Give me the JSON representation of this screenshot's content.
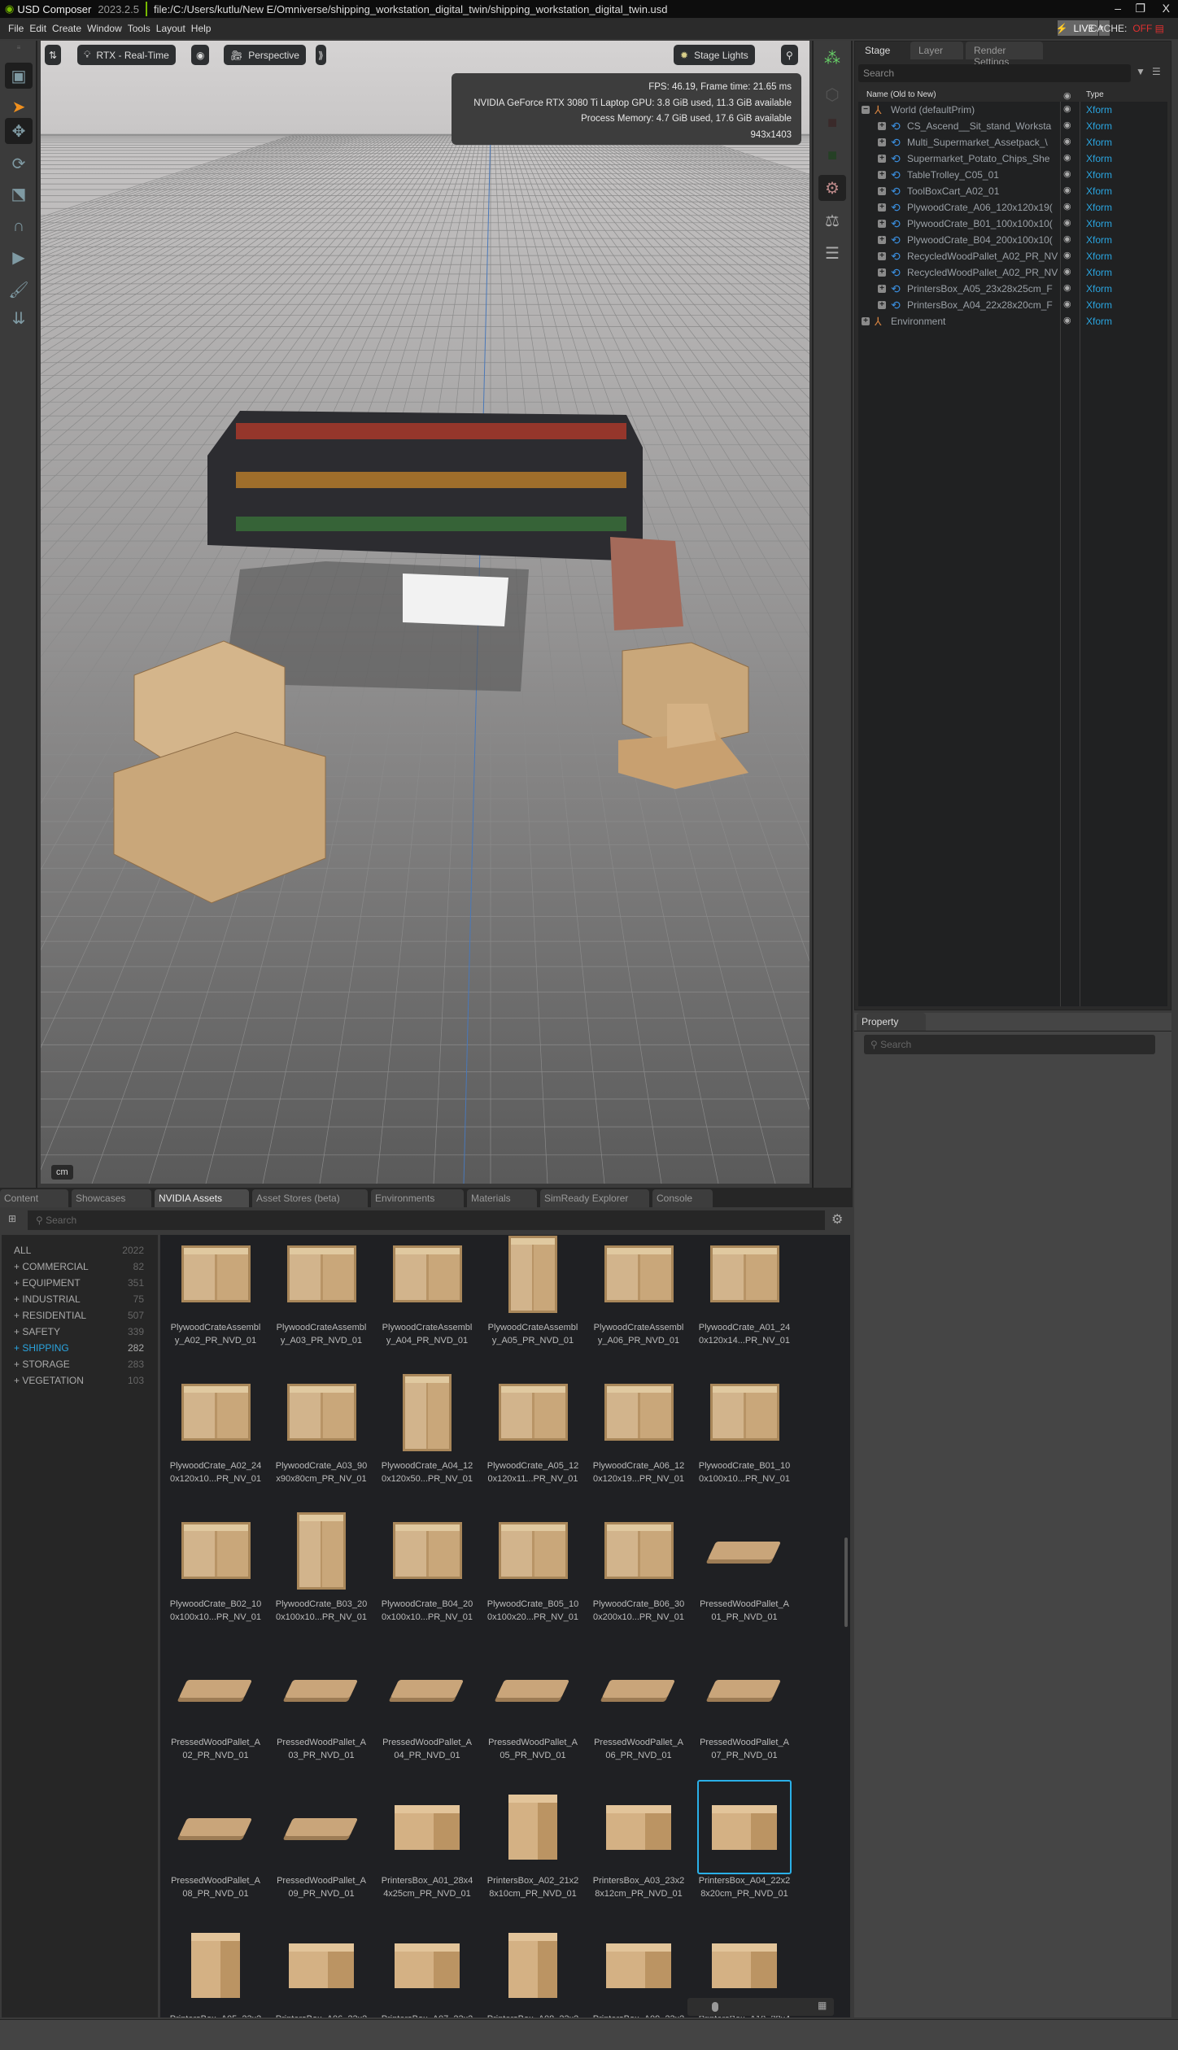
{
  "titlebar": {
    "app": "USD Composer",
    "version": "2023.2.5",
    "path": "file:/C:/Users/kutlu/New E/Omniverse/shipping_workstation_digital_twin/shipping_workstation_digital_twin.usd",
    "min": "–",
    "restore": "❐",
    "close": "X"
  },
  "menu": [
    "File",
    "Edit",
    "Create",
    "Window",
    "Tools",
    "Layout",
    "Help"
  ],
  "live": {
    "label": "LIVE",
    "cache_label": "CACHE:",
    "cache_state": "OFF"
  },
  "viewport": {
    "render_mode": "RTX - Real-Time",
    "camera": "Perspective",
    "stage_lights": "Stage Lights",
    "stats": [
      "FPS: 46.19, Frame time: 21.65 ms",
      "NVIDIA GeForce RTX 3080 Ti Laptop GPU: 3.8 GiB used, 11.3 GiB available",
      "Process Memory: 4.7 GiB used, 17.6 GiB available",
      "943x1403"
    ],
    "unit": "cm"
  },
  "stage": {
    "tabs": [
      "Stage",
      "Layer",
      "Render Settings"
    ],
    "search_placeholder": "Search",
    "col_name": "Name (Old to New)",
    "col_type": "Type",
    "items": [
      {
        "name": "World (defaultPrim)",
        "type": "Xform",
        "level": 0,
        "expanded": true
      },
      {
        "name": "CS_Ascend__Sit_stand_Worksta",
        "type": "Xform",
        "level": 1
      },
      {
        "name": "Multi_Supermarket_Assetpack_\\",
        "type": "Xform",
        "level": 1
      },
      {
        "name": "Supermarket_Potato_Chips_She",
        "type": "Xform",
        "level": 1
      },
      {
        "name": "TableTrolley_C05_01",
        "type": "Xform",
        "level": 1
      },
      {
        "name": "ToolBoxCart_A02_01",
        "type": "Xform",
        "level": 1
      },
      {
        "name": "PlywoodCrate_A06_120x120x19(",
        "type": "Xform",
        "level": 1
      },
      {
        "name": "PlywoodCrate_B01_100x100x10(",
        "type": "Xform",
        "level": 1
      },
      {
        "name": "PlywoodCrate_B04_200x100x10(",
        "type": "Xform",
        "level": 1
      },
      {
        "name": "RecycledWoodPallet_A02_PR_NV",
        "type": "Xform",
        "level": 1
      },
      {
        "name": "RecycledWoodPallet_A02_PR_NV",
        "type": "Xform",
        "level": 1
      },
      {
        "name": "PrintersBox_A05_23x28x25cm_F",
        "type": "Xform",
        "level": 1
      },
      {
        "name": "PrintersBox_A04_22x28x20cm_F",
        "type": "Xform",
        "level": 1
      },
      {
        "name": "Environment",
        "type": "Xform",
        "level": 0,
        "expanded": false
      }
    ]
  },
  "property": {
    "tab": "Property",
    "search_placeholder": "Search"
  },
  "bottom": {
    "tabs": [
      "Content",
      "Showcases",
      "NVIDIA Assets",
      "Asset Stores (beta)",
      "Environments",
      "Materials",
      "SimReady Explorer",
      "Console"
    ],
    "active_tab": "NVIDIA Assets",
    "search_placeholder": "Search",
    "categories": [
      {
        "label": "ALL",
        "count": "2022"
      },
      {
        "label": "+ COMMERCIAL",
        "count": "82"
      },
      {
        "label": "+ EQUIPMENT",
        "count": "351"
      },
      {
        "label": "+ INDUSTRIAL",
        "count": "75"
      },
      {
        "label": "+ RESIDENTIAL",
        "count": "507"
      },
      {
        "label": "+ SAFETY",
        "count": "339"
      },
      {
        "label": "+ SHIPPING",
        "count": "282",
        "active": true
      },
      {
        "label": "+ STORAGE",
        "count": "283"
      },
      {
        "label": "+ VEGETATION",
        "count": "103"
      }
    ],
    "assets": [
      {
        "label": "PlywoodCrateAssembl\ny_A02_PR_NVD_01",
        "kind": "crate"
      },
      {
        "label": "PlywoodCrateAssembl\ny_A03_PR_NVD_01",
        "kind": "crate"
      },
      {
        "label": "PlywoodCrateAssembl\ny_A04_PR_NVD_01",
        "kind": "crate"
      },
      {
        "label": "PlywoodCrateAssembl\ny_A05_PR_NVD_01",
        "kind": "crate"
      },
      {
        "label": "PlywoodCrateAssembl\ny_A06_PR_NVD_01",
        "kind": "crate"
      },
      {
        "label": "PlywoodCrate_A01_24\n0x120x14...PR_NV_01",
        "kind": "crate"
      },
      {
        "label": "PlywoodCrate_A02_24\n0x120x10...PR_NV_01",
        "kind": "crate"
      },
      {
        "label": "PlywoodCrate_A03_90\nx90x80cm_PR_NV_01",
        "kind": "crate"
      },
      {
        "label": "PlywoodCrate_A04_12\n0x120x50...PR_NV_01",
        "kind": "crate"
      },
      {
        "label": "PlywoodCrate_A05_12\n0x120x11...PR_NV_01",
        "kind": "crate"
      },
      {
        "label": "PlywoodCrate_A06_12\n0x120x19...PR_NV_01",
        "kind": "crate"
      },
      {
        "label": "PlywoodCrate_B01_10\n0x100x10...PR_NV_01",
        "kind": "crate"
      },
      {
        "label": "PlywoodCrate_B02_10\n0x100x10...PR_NV_01",
        "kind": "crate"
      },
      {
        "label": "PlywoodCrate_B03_20\n0x100x10...PR_NV_01",
        "kind": "crate"
      },
      {
        "label": "PlywoodCrate_B04_20\n0x100x10...PR_NV_01",
        "kind": "crate"
      },
      {
        "label": "PlywoodCrate_B05_10\n0x100x20...PR_NV_01",
        "kind": "crate"
      },
      {
        "label": "PlywoodCrate_B06_30\n0x200x10...PR_NV_01",
        "kind": "crate"
      },
      {
        "label": "PressedWoodPallet_A\n01_PR_NVD_01",
        "kind": "pallet"
      },
      {
        "label": "PressedWoodPallet_A\n02_PR_NVD_01",
        "kind": "pallet"
      },
      {
        "label": "PressedWoodPallet_A\n03_PR_NVD_01",
        "kind": "pallet"
      },
      {
        "label": "PressedWoodPallet_A\n04_PR_NVD_01",
        "kind": "pallet"
      },
      {
        "label": "PressedWoodPallet_A\n05_PR_NVD_01",
        "kind": "pallet"
      },
      {
        "label": "PressedWoodPallet_A\n06_PR_NVD_01",
        "kind": "pallet"
      },
      {
        "label": "PressedWoodPallet_A\n07_PR_NVD_01",
        "kind": "pallet"
      },
      {
        "label": "PressedWoodPallet_A\n08_PR_NVD_01",
        "kind": "pallet"
      },
      {
        "label": "PressedWoodPallet_A\n09_PR_NVD_01",
        "kind": "pallet"
      },
      {
        "label": "PrintersBox_A01_28x4\n4x25cm_PR_NVD_01",
        "kind": "box"
      },
      {
        "label": "PrintersBox_A02_21x2\n8x10cm_PR_NVD_01",
        "kind": "box"
      },
      {
        "label": "PrintersBox_A03_23x2\n8x12cm_PR_NVD_01",
        "kind": "box"
      },
      {
        "label": "PrintersBox_A04_22x2\n8x20cm_PR_NVD_01",
        "kind": "box",
        "selected": true
      },
      {
        "label": "PrintersBox_A05_23x2",
        "kind": "box"
      },
      {
        "label": "PrintersBox_A06_23x2",
        "kind": "box"
      },
      {
        "label": "PrintersBox_A07_23x2",
        "kind": "box"
      },
      {
        "label": "PrintersBox_A08_23x2",
        "kind": "box"
      },
      {
        "label": "PrintersBox_A09_23x2",
        "kind": "box"
      },
      {
        "label": "PrintersBox_A10_28x4",
        "kind": "box"
      }
    ]
  },
  "colors": {
    "accent": "#2aa5e0",
    "nvidia_green": "#76b900",
    "cache_off": "#e03030",
    "select_tool": "#f0901e"
  }
}
